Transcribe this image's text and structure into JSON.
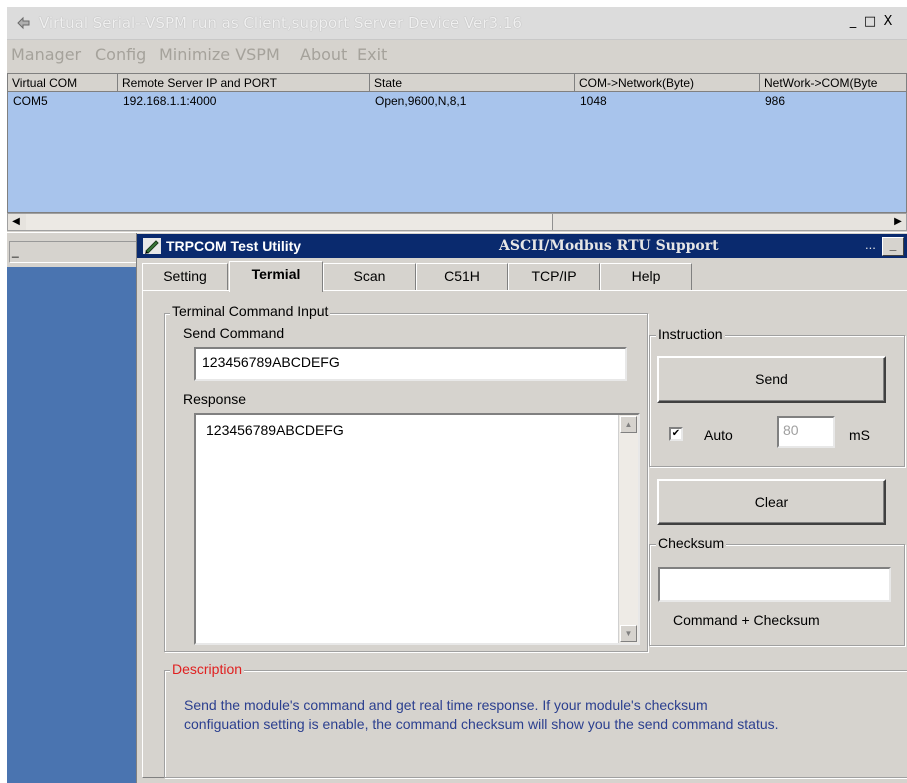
{
  "background_window": {
    "title": "Virtual Serial--VSPM run as Client,support Server Device  Ver3.16",
    "controls": {
      "minimize": "_",
      "maximize": "□",
      "close": "X"
    },
    "menu": [
      "Manager",
      "Config",
      "Minimize VSPM",
      "About",
      "Exit"
    ],
    "columns": [
      "Virtual COM",
      "Remote Server IP and PORT",
      "State",
      "COM->Network(Byte)",
      "NetWork->COM(Byte"
    ],
    "rows": [
      [
        "COM5",
        "192.168.1.1:4000",
        "Open,9600,N,8,1",
        "1048",
        "986"
      ]
    ],
    "scroll_left": "◀",
    "scroll_right": "▶",
    "status_text": "_"
  },
  "utility_window": {
    "title": "TRPCOM Test Utility",
    "subtitle": "ASCII/Modbus RTU Support",
    "title_dots": "...",
    "minimize": "_",
    "tabs": [
      "Setting",
      "Termial",
      "Scan",
      "C51H",
      "TCP/IP",
      "Help"
    ],
    "active_tab": "Termial",
    "terminal_group_label": "Terminal Command Input",
    "send_command_label": "Send Command",
    "send_command_value": "123456789ABCDEFG",
    "response_label": "Response",
    "response_value": "123456789ABCDEFG",
    "instruction_label": "Instruction",
    "send_button": "Send",
    "auto_checked": true,
    "auto_check_mark": "✔",
    "auto_label": "Auto",
    "interval_value": "80",
    "interval_unit": "mS",
    "clear_button": "Clear",
    "checksum_label": "Checksum",
    "checksum_value": "",
    "checksum_caption": "Command + Checksum",
    "description_label": "Description",
    "description_line1": "Send the module's command and get  real time response. If your module's checksum",
    "description_line2": "configuation setting is enable, the command checksum will show you the send command status.",
    "scroll_up": "▲",
    "scroll_down": "▼"
  },
  "colors": {
    "title_bar": "#0a2a6e",
    "list_selection": "#a8c4ec",
    "desktop": "#4a74b0",
    "description_label": "#e02020",
    "description_text": "#2b3f8f"
  }
}
